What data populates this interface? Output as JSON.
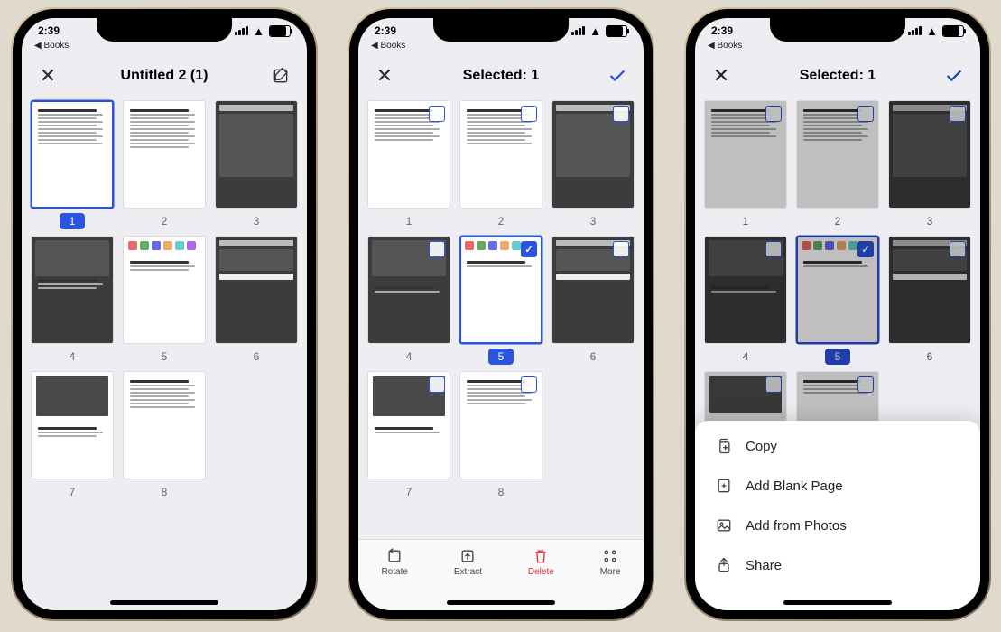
{
  "status": {
    "time": "2:39",
    "back_app": "◀ Books"
  },
  "phone1": {
    "title": "Untitled 2 (1)",
    "pages": [
      1,
      2,
      3,
      4,
      5,
      6,
      7,
      8
    ],
    "selected_page": 1
  },
  "phone2": {
    "title": "Selected: 1",
    "pages": [
      1,
      2,
      3,
      4,
      5,
      6,
      7,
      8
    ],
    "selected_page": 5,
    "toolbar": {
      "rotate": "Rotate",
      "extract": "Extract",
      "delete": "Delete",
      "more": "More"
    }
  },
  "phone3": {
    "title": "Selected: 1",
    "pages": [
      1,
      2,
      3,
      4,
      5,
      6
    ],
    "selected_page": 5,
    "sheet": {
      "copy": "Copy",
      "blank": "Add Blank Page",
      "photos": "Add from Photos",
      "share": "Share"
    }
  }
}
